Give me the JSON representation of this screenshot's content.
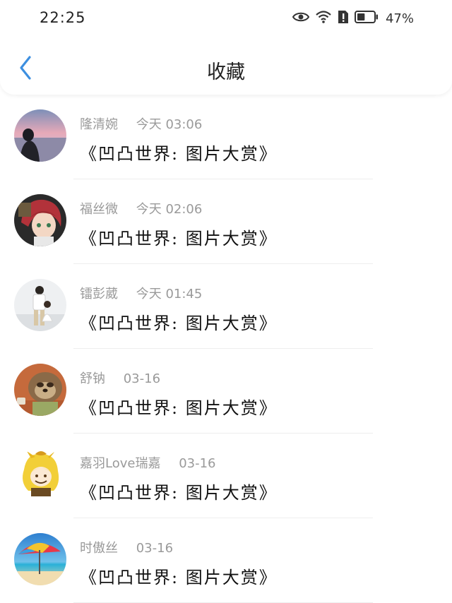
{
  "status_bar": {
    "time": "22:25",
    "battery_percent": "47%",
    "battery_level": 0.47
  },
  "nav": {
    "title": "收藏"
  },
  "items": [
    {
      "author": "隆清婉",
      "time": "今天 03:06",
      "title": "《凹凸世界: 图片大赏》",
      "avatar": "photo-girl-sunset"
    },
    {
      "author": "福丝微",
      "time": "今天 02:06",
      "title": "《凹凸世界: 图片大赏》",
      "avatar": "anime-red-hair"
    },
    {
      "author": "镭彭葳",
      "time": "今天 01:45",
      "title": "《凹凸世界: 图片大赏》",
      "avatar": "photo-man-child"
    },
    {
      "author": "舒钠",
      "time": "03-16",
      "title": "《凹凸世界: 图片大赏》",
      "avatar": "sloth-cartoon"
    },
    {
      "author": "嘉羽Love瑞嘉",
      "time": "03-16",
      "title": "《凹凸世界: 图片大赏》",
      "avatar": "anime-yellow-hair"
    },
    {
      "author": "时傲丝",
      "time": "03-16",
      "title": "《凹凸世界: 图片大赏》",
      "avatar": "beach-umbrella"
    }
  ],
  "colors": {
    "accent": "#3d8fe0",
    "meta_text": "#9a9a9a",
    "title_text": "#111111",
    "divider": "#eeeeee"
  }
}
